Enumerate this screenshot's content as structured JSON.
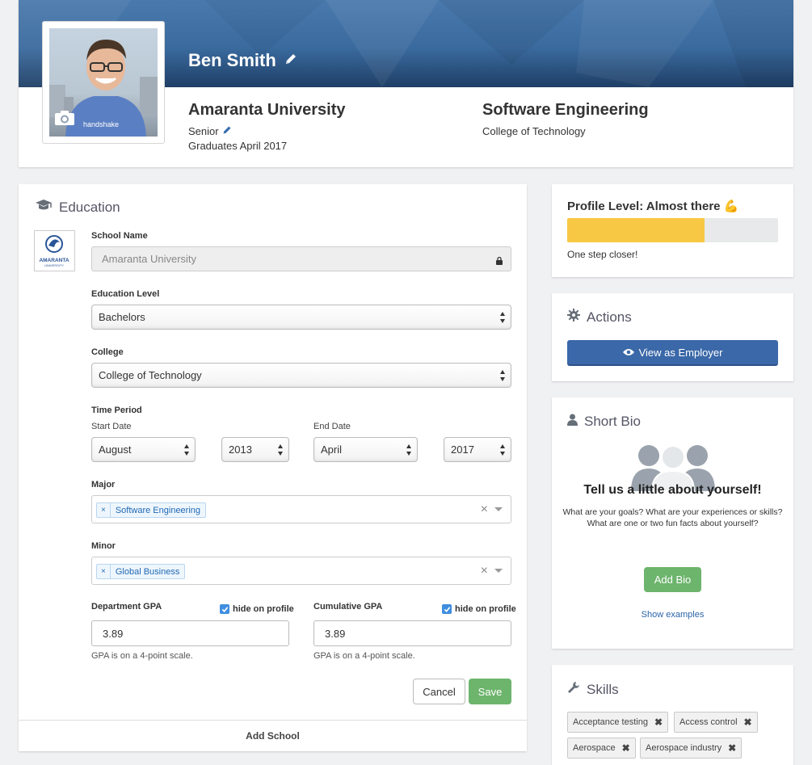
{
  "profile": {
    "name": "Ben Smith",
    "university": "Amaranta University",
    "year": "Senior",
    "graduation": "Graduates April 2017",
    "major": "Software Engineering",
    "college": "College of Technology",
    "shirt_text": "handshake"
  },
  "education": {
    "section_title": "Education",
    "logo_text": "AMARANTA",
    "logo_subtext": "UNIVERSITY",
    "school_name_label": "School Name",
    "school_name_value": "Amaranta University",
    "education_level_label": "Education Level",
    "education_level_value": "Bachelors",
    "college_label": "College",
    "college_value": "College of Technology",
    "time_period_label": "Time Period",
    "start_date_label": "Start Date",
    "start_month": "August",
    "start_year": "2013",
    "end_date_label": "End Date",
    "end_month": "April",
    "end_year": "2017",
    "major_label": "Major",
    "major_tag": "Software Engineering",
    "minor_label": "Minor",
    "minor_tag": "Global Business",
    "dept_gpa_label": "Department GPA",
    "dept_gpa_value": "3.89",
    "cum_gpa_label": "Cumulative GPA",
    "cum_gpa_value": "3.89",
    "hide_on_profile": "hide on profile",
    "gpa_note": "GPA is on a 4-point scale.",
    "cancel": "Cancel",
    "save": "Save",
    "add_school": "Add School"
  },
  "profile_level": {
    "title": "Profile Level: Almost there 💪",
    "progress_fraction": 0.65,
    "note": "One step closer!"
  },
  "actions": {
    "title": "Actions",
    "view_as_employer": "View as Employer"
  },
  "short_bio": {
    "title": "Short Bio",
    "heading": "Tell us a little about yourself!",
    "body": "What are your goals? What are your experiences or skills? What are one or two fun facts about yourself?",
    "add_bio": "Add Bio",
    "show_examples": "Show examples"
  },
  "skills": {
    "title": "Skills",
    "items": [
      "Acceptance testing",
      "Access control",
      "Aerospace",
      "Aerospace industry"
    ]
  },
  "colors": {
    "banner": "#3a6a9e",
    "primary": "#3b68a8",
    "success": "#6db46d",
    "progress": "#f7c843"
  }
}
